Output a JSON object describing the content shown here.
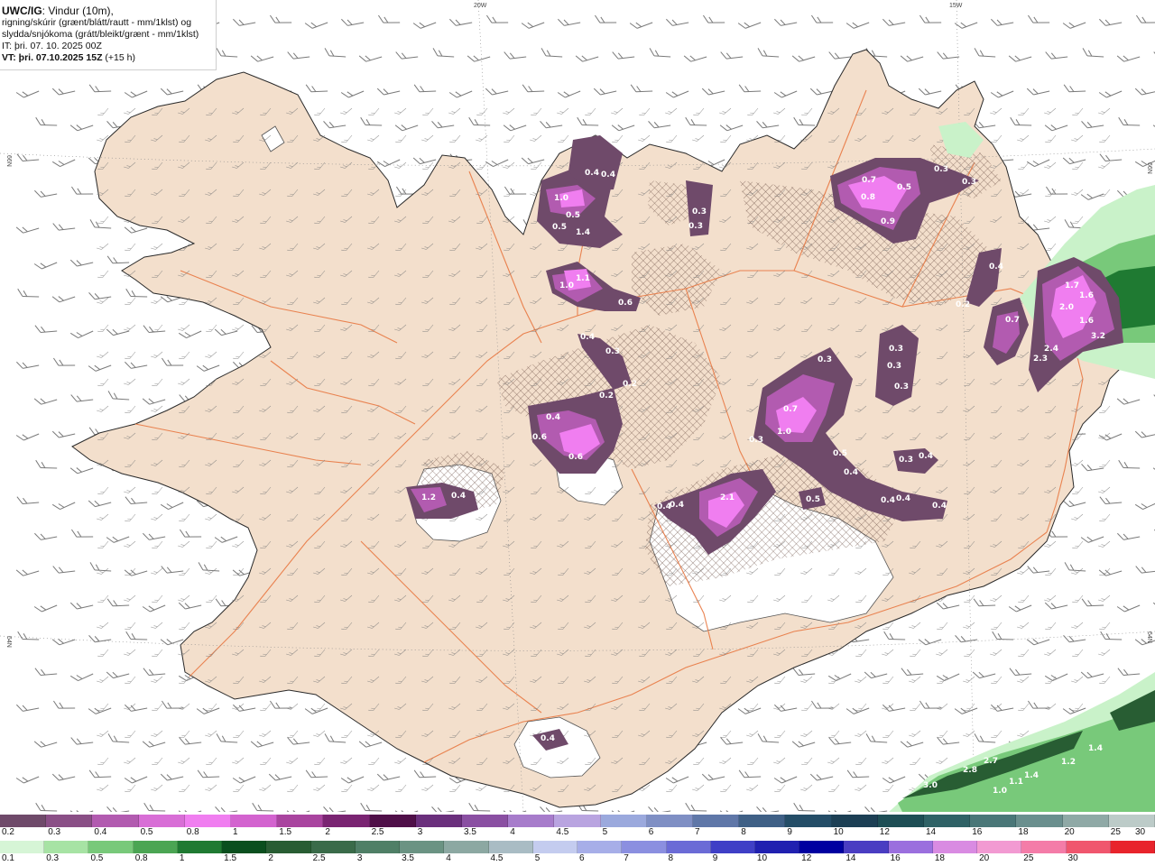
{
  "header": {
    "product": "UWC/IG",
    "line1": ": Vindur (10m),",
    "line2": "rigning/skúrir (grænt/blátt/rautt - mm/1klst) og",
    "line3": "slydda/snjókoma (grátt/bleikt/grænt - mm/1klst)",
    "init_time": "IT: þri. 07. 10. 2025 00Z",
    "valid_label": "VT: þri. 07.10.2025 15Z",
    "valid_offset": " (+15 h)"
  },
  "grid_labels": {
    "lon_20w": "20W",
    "lon_15w": "15W",
    "lat_66n_left": "66N",
    "lat_66n_right": "66N",
    "lat_64n_left": "64N",
    "lat_64n_right": "64N"
  },
  "snow_labels": [
    "0.4",
    "0.4",
    "1.0",
    "0.5",
    "0.5",
    "1.4",
    "1.1",
    "1.0",
    "0.6",
    "0.4",
    "0.3",
    "0.2",
    "0.2",
    "0.4",
    "0.6",
    "0.6",
    "1.2",
    "0.4",
    "0.3",
    "0.3",
    "0.7",
    "0.8",
    "0.5",
    "0.9",
    "0.3",
    "0.3",
    "0.4",
    "0.2",
    "0.7",
    "1.7",
    "1.6",
    "2.0",
    "1.6",
    "2.4",
    "3.2",
    "2.3",
    "0.3",
    "0.3",
    "0.3",
    "0.3",
    "0.7",
    "1.0",
    "0.3",
    "0.5",
    "0.4",
    "0.3",
    "0.4",
    "0.5",
    "0.4",
    "0.4",
    "0.4",
    "2.1",
    "0.4",
    "0.4",
    "0.4"
  ],
  "rain_labels": [
    "3.0",
    "2.8",
    "2.7",
    "1.0",
    "1.1",
    "1.4",
    "1.2",
    "1.4"
  ],
  "legend": {
    "snow": {
      "ticks": [
        "0.2",
        "0.3",
        "0.4",
        "0.5",
        "0.8",
        "1",
        "1.5",
        "2",
        "2.5",
        "3",
        "3.5",
        "4",
        "4.5",
        "5",
        "6",
        "7",
        "8",
        "9",
        "10",
        "12",
        "14",
        "16",
        "18",
        "20",
        "25",
        "30"
      ],
      "colors": [
        "#6f4a6a",
        "#8a4f86",
        "#b25bb0",
        "#d86ed6",
        "#f07ef0",
        "#d363cf",
        "#a9449f",
        "#7a2472",
        "#4f0f48",
        "#6a2f7c",
        "#8a4fa2",
        "#a77ccb",
        "#b9a4e0",
        "#9ba9dd",
        "#7f8fc4",
        "#5f77a8",
        "#3f6086",
        "#244d67",
        "#1c3f54",
        "#1e4e55",
        "#2f6266",
        "#4a7778",
        "#6a8f8e",
        "#8fa9a6",
        "#bccbc8"
      ]
    },
    "rain": {
      "ticks": [
        "0.1",
        "0.3",
        "0.5",
        "0.8",
        "1",
        "1.5",
        "2",
        "2.5",
        "3",
        "3.5",
        "4",
        "4.5",
        "5",
        "6",
        "7",
        "8",
        "9",
        "10",
        "12",
        "14",
        "16",
        "18",
        "20",
        "25",
        "30"
      ],
      "colors": [
        "#d6f5d6",
        "#a7e3a4",
        "#78c97a",
        "#4ba553",
        "#1f7a32",
        "#0a4f1e",
        "#285d33",
        "#3a6b49",
        "#4f7f66",
        "#6b9383",
        "#8ca8a2",
        "#a9bcc4",
        "#c4ccef",
        "#a7aee8",
        "#8b8fe0",
        "#6b6bd6",
        "#3f3fc6",
        "#2020b0",
        "#0000a0",
        "#4a3dc2",
        "#9b6fde",
        "#d98be2",
        "#f29ad2",
        "#f47ca8",
        "#f0566e"
      ],
      "last_color": "#e8242c"
    }
  },
  "colors": {
    "land": "#f3dfcc",
    "road": "#e87842",
    "glacier": "#ffffff",
    "wind_barb": "#7a7a7a",
    "snow_light": "#6f4a6a",
    "snow_mid": "#b25bb0",
    "snow_strong": "#f07ef0",
    "rain_light": "#c9f2c9",
    "rain_mid": "#4ba553",
    "rain_strong": "#0a4f1e"
  }
}
